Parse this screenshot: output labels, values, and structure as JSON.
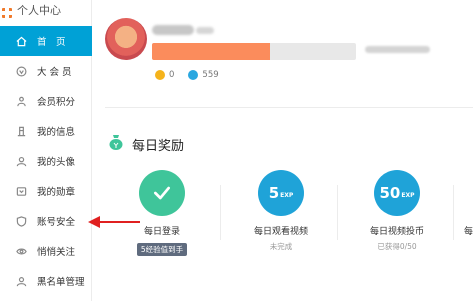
{
  "sidebar": {
    "title": "个人中心",
    "items": [
      {
        "label": "首　页",
        "icon": "home-icon",
        "active": true
      },
      {
        "label": "大 会 员",
        "icon": "vip-icon",
        "active": false
      },
      {
        "label": "会员积分",
        "icon": "points-icon",
        "active": false
      },
      {
        "label": "我的信息",
        "icon": "user-info-icon",
        "active": false
      },
      {
        "label": "我的头像",
        "icon": "avatar-icon",
        "active": false
      },
      {
        "label": "我的勋章",
        "icon": "medal-icon",
        "active": false
      },
      {
        "label": "账号安全",
        "icon": "shield-icon",
        "active": false
      },
      {
        "label": "悄悄关注",
        "icon": "eye-icon",
        "active": false
      },
      {
        "label": "黑名单管理",
        "icon": "block-icon",
        "active": false
      }
    ]
  },
  "profile": {
    "coins": "0",
    "bcoins": "559",
    "exp_progress": 0.58
  },
  "daily": {
    "title": "每日奖励",
    "rewards": [
      {
        "value": "",
        "unit": "",
        "label": "每日登录",
        "status": "5经验值到手",
        "color": "green"
      },
      {
        "value": "5",
        "unit": "EXP",
        "label": "每日观看视频",
        "status": "未完成",
        "color": "blue"
      },
      {
        "value": "50",
        "unit": "EXP",
        "label": "每日视频投币",
        "status": "已获得0/50",
        "color": "blue"
      },
      {
        "value": "",
        "unit": "",
        "label": "每",
        "status": "",
        "color": "none"
      }
    ]
  },
  "colors": {
    "accent": "#00a1d6",
    "arrow": "#e02020"
  }
}
